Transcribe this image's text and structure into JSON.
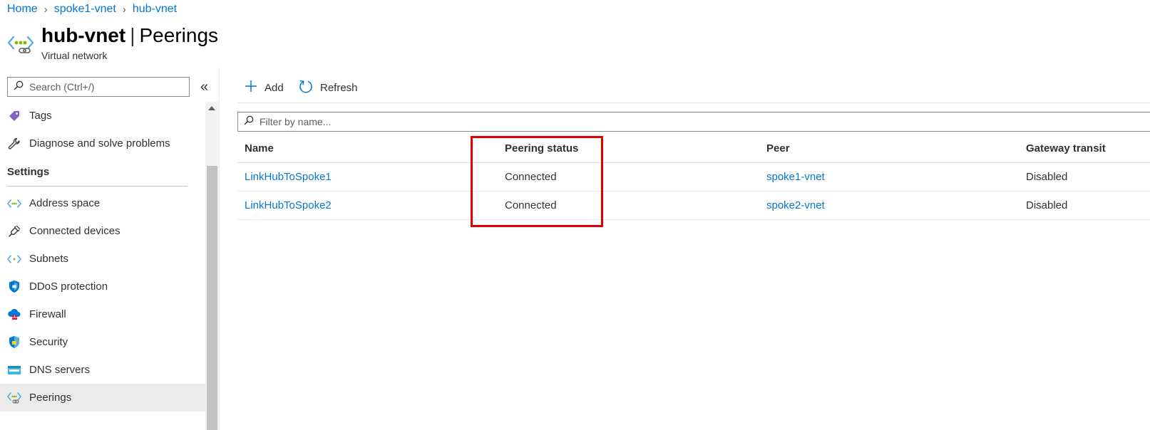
{
  "breadcrumb": [
    {
      "label": "Home"
    },
    {
      "label": "spoke1-vnet"
    },
    {
      "label": "hub-vnet"
    }
  ],
  "header": {
    "resource_name": "hub-vnet",
    "separator": "|",
    "blade_name": "Peerings",
    "subtitle": "Virtual network"
  },
  "nav": {
    "search_placeholder": "Search (Ctrl+/)",
    "collapse_glyph": "«",
    "items_top": [
      {
        "label": "Tags",
        "icon": "tag-icon"
      },
      {
        "label": "Diagnose and solve problems",
        "icon": "wrench-icon"
      }
    ],
    "section_title": "Settings",
    "items_settings": [
      {
        "label": "Address space",
        "icon": "address-space-icon"
      },
      {
        "label": "Connected devices",
        "icon": "plug-icon"
      },
      {
        "label": "Subnets",
        "icon": "subnet-icon"
      },
      {
        "label": "DDoS protection",
        "icon": "ddos-shield-icon"
      },
      {
        "label": "Firewall",
        "icon": "firewall-icon"
      },
      {
        "label": "Security",
        "icon": "security-shield-icon"
      },
      {
        "label": "DNS servers",
        "icon": "dns-icon"
      },
      {
        "label": "Peerings",
        "icon": "peerings-icon",
        "selected": true
      }
    ]
  },
  "toolbar": {
    "add_label": "Add",
    "refresh_label": "Refresh"
  },
  "filter": {
    "placeholder": "Filter by name..."
  },
  "table": {
    "columns": [
      "Name",
      "Peering status",
      "Peer",
      "Gateway transit"
    ],
    "rows": [
      {
        "name": "LinkHubToSpoke1",
        "status": "Connected",
        "peer": "spoke1-vnet",
        "gateway_transit": "Disabled"
      },
      {
        "name": "LinkHubToSpoke2",
        "status": "Connected",
        "peer": "spoke2-vnet",
        "gateway_transit": "Disabled"
      }
    ]
  },
  "colors": {
    "link": "#0078d4",
    "highlight": "#e00000",
    "selected_bg": "#edebe9"
  }
}
